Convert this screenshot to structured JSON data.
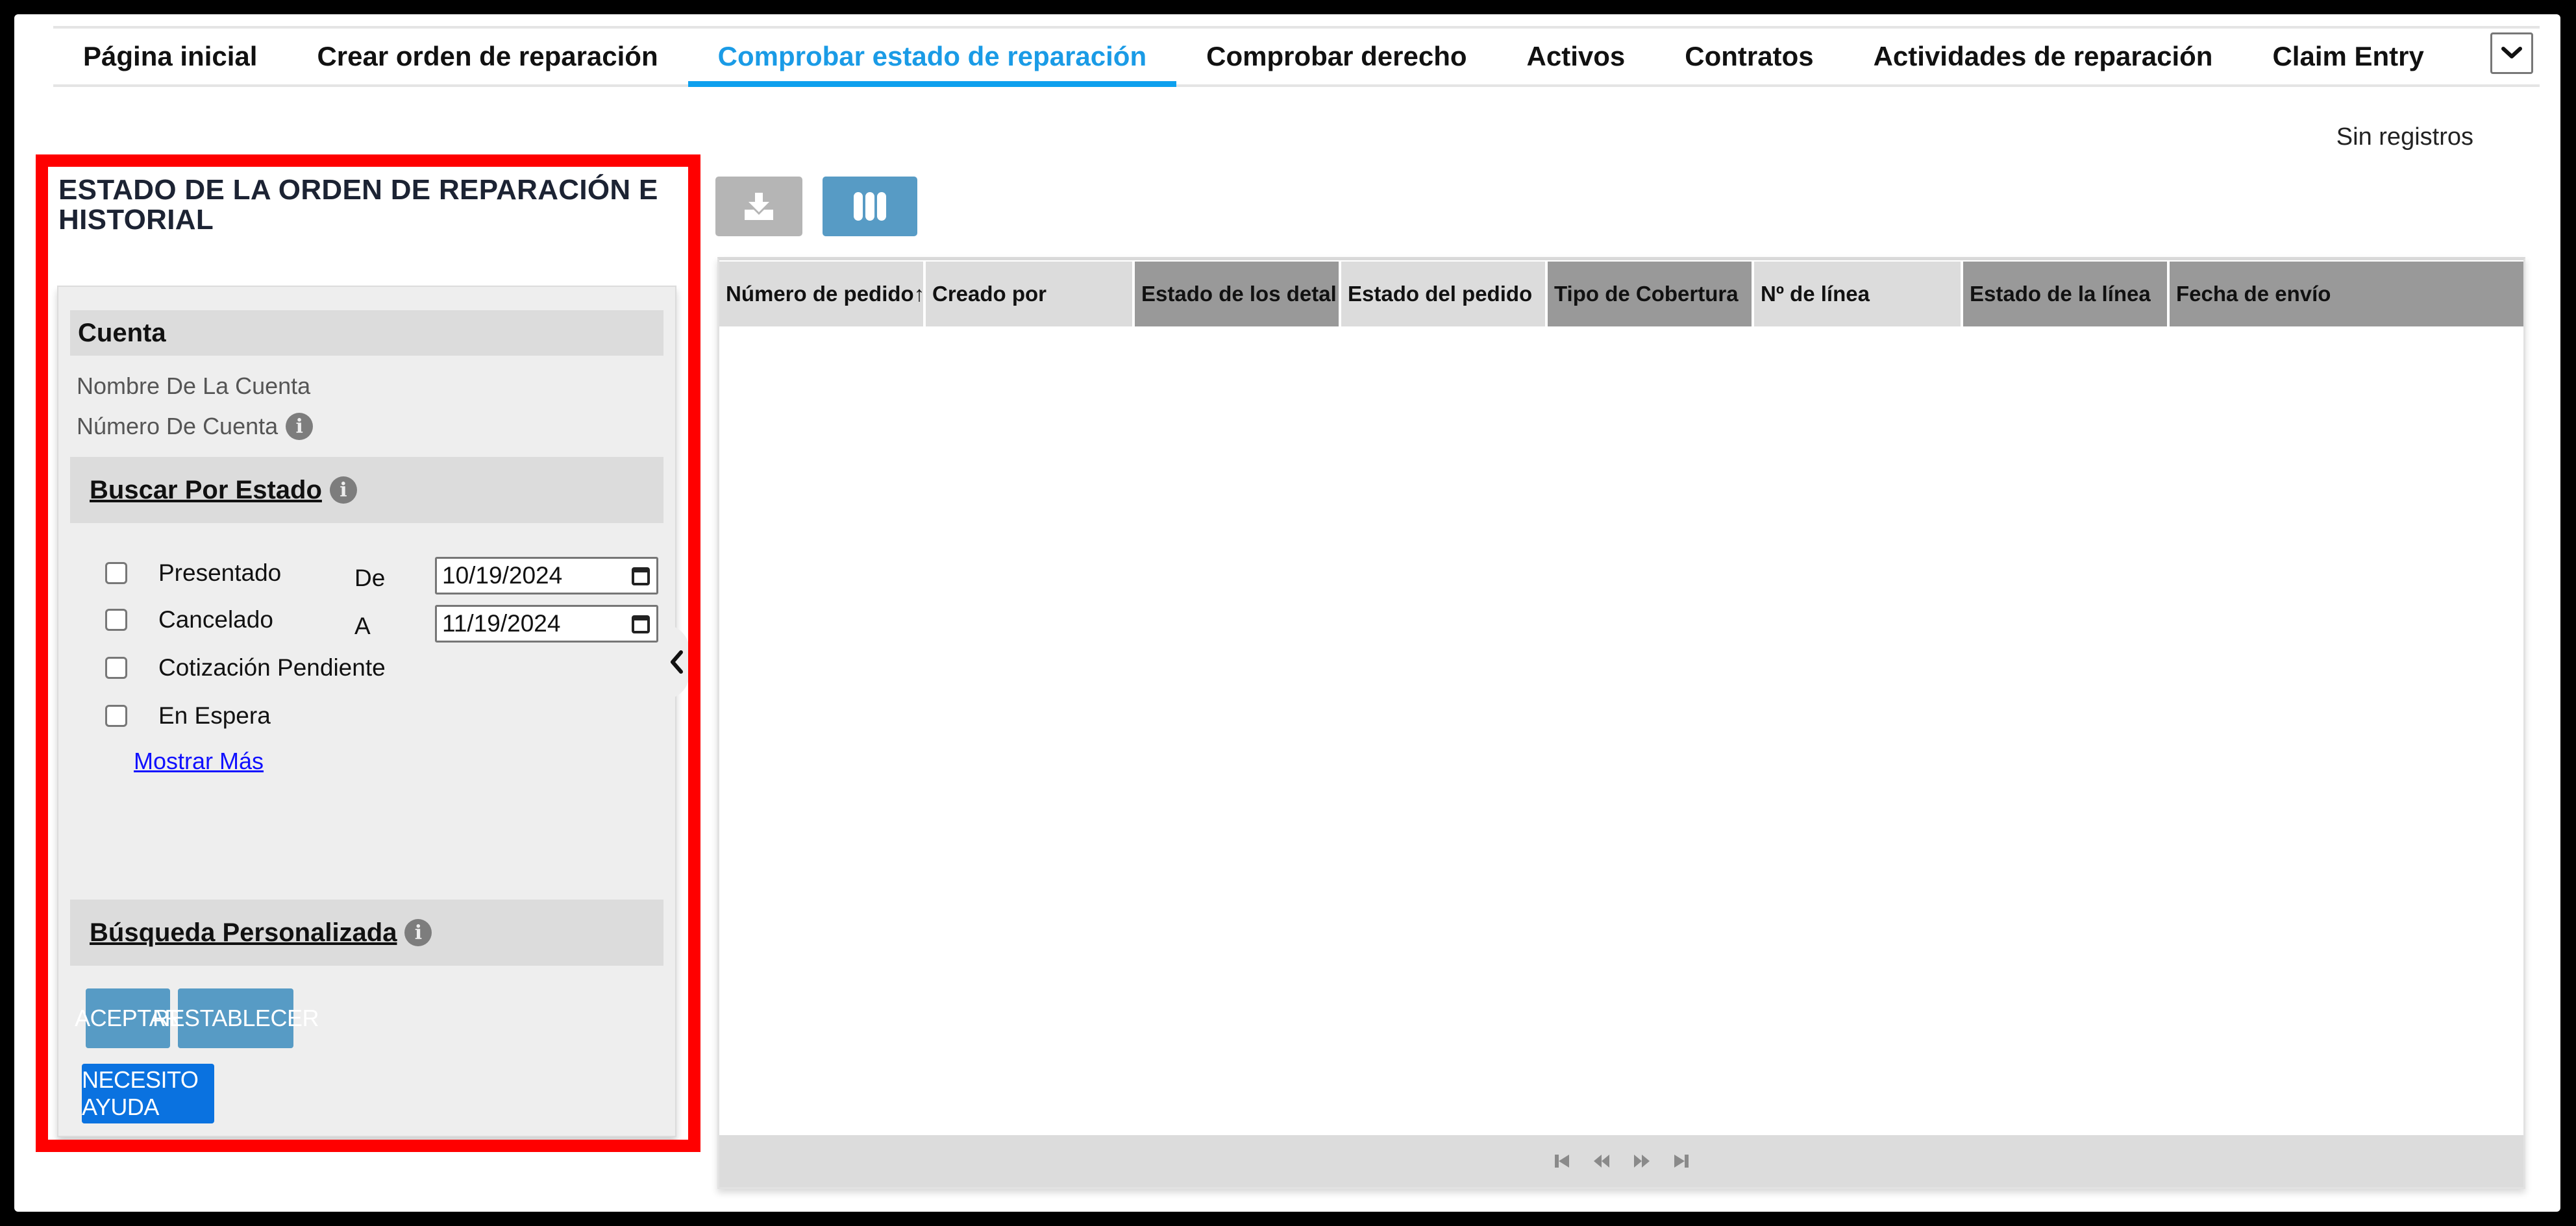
{
  "nav": {
    "tabs": [
      {
        "label": "Página inicial",
        "active": false
      },
      {
        "label": "Crear orden de reparación",
        "active": false
      },
      {
        "label": "Comprobar estado de reparación",
        "active": true
      },
      {
        "label": "Comprobar derecho",
        "active": false
      },
      {
        "label": "Activos",
        "active": false
      },
      {
        "label": "Contratos",
        "active": false
      },
      {
        "label": "Actividades de reparación",
        "active": false
      },
      {
        "label": "Claim Entry",
        "active": false
      }
    ],
    "more_icon": "chevron-down-icon"
  },
  "left": {
    "title": "ESTADO DE LA ORDEN DE REPARACIÓN E HISTORIAL",
    "account": {
      "header": "Cuenta",
      "name_label": "Nombre De La Cuenta",
      "name_value": "",
      "number_label": "Número De Cuenta",
      "number_value": ""
    },
    "status_search": {
      "header": "Buscar Por Estado",
      "statuses": [
        {
          "label": "Presentado",
          "checked": false
        },
        {
          "label": "Cancelado",
          "checked": false
        },
        {
          "label": "Cotización Pendiente",
          "checked": false
        },
        {
          "label": "En Espera",
          "checked": false
        }
      ],
      "from_label": "De",
      "from_value": "10/19/2024",
      "to_label": "A",
      "to_value": "11/19/2024",
      "show_more": "Mostrar Más"
    },
    "custom_search": {
      "header": "Búsqueda Personalizada"
    },
    "buttons": {
      "accept": "ACEPTAR",
      "reset": "RESTABLECER",
      "help": "NECESITO AYUDA"
    }
  },
  "right": {
    "records_label": "Sin registros",
    "toolbar": {
      "export_icon": "download-icon",
      "columns_icon": "columns-icon"
    },
    "table": {
      "columns": [
        {
          "label": "Número de pedido",
          "shade": "light"
        },
        {
          "label": "Creado por",
          "shade": "light"
        },
        {
          "label": "Estado de los detal",
          "shade": "dark"
        },
        {
          "label": "Estado del pedido",
          "shade": "light"
        },
        {
          "label": "Tipo de Cobertura",
          "shade": "dark"
        },
        {
          "label": "Nº de línea",
          "shade": "light"
        },
        {
          "label": "Estado de la línea",
          "shade": "dark"
        },
        {
          "label": "Fecha de envío",
          "shade": "dark"
        }
      ],
      "rows": []
    },
    "pager": {
      "first": "first-page-icon",
      "prev": "previous-page-icon",
      "next": "next-page-icon",
      "last": "last-page-icon"
    }
  },
  "colors": {
    "accent": "#0ea0ee",
    "highlight": "#ff0000",
    "button": "#579bc5",
    "help_button": "#0a72e0",
    "link": "#1010ff"
  }
}
